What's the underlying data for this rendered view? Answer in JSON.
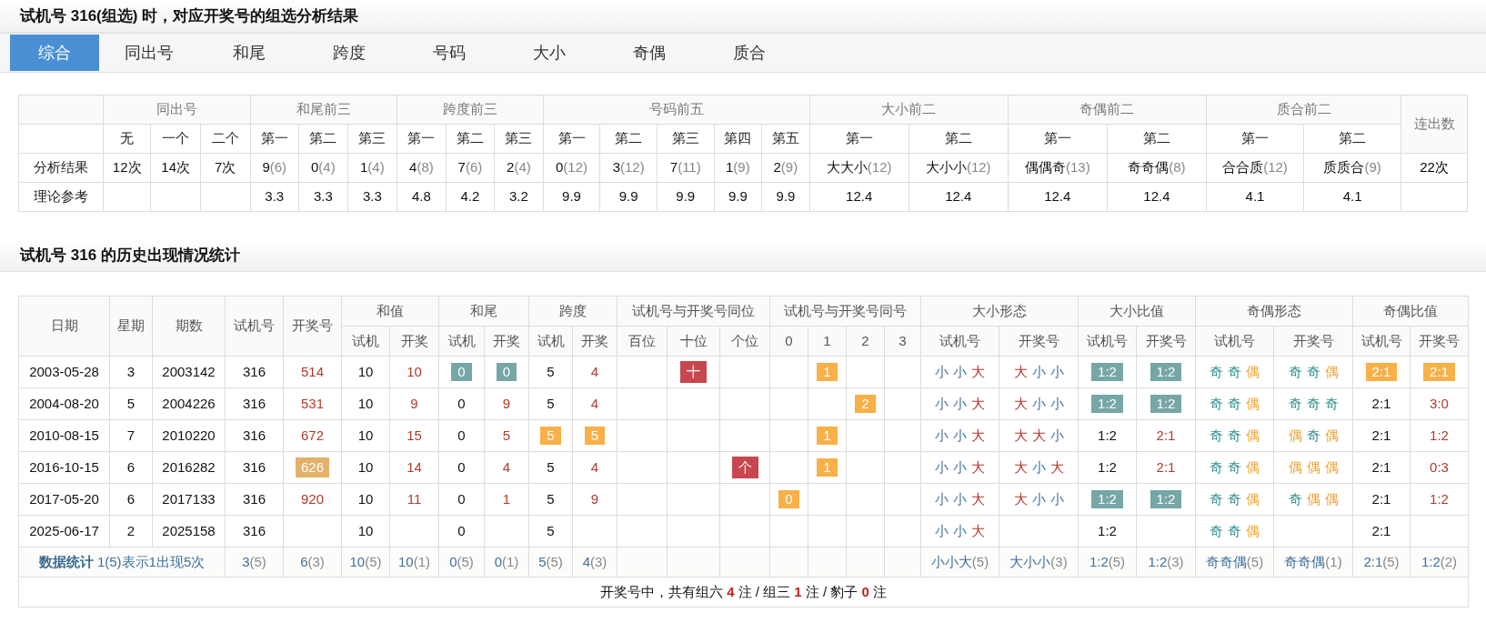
{
  "title": "试机号 316(组选) 时，对应开奖号的组选分析结果",
  "tabs": [
    {
      "label": "综合",
      "selected": true
    },
    {
      "label": "同出号",
      "selected": false
    },
    {
      "label": "和尾",
      "selected": false
    },
    {
      "label": "跨度",
      "selected": false
    },
    {
      "label": "号码",
      "selected": false
    },
    {
      "label": "大小",
      "selected": false
    },
    {
      "label": "奇偶",
      "selected": false
    },
    {
      "label": "质合",
      "selected": false
    }
  ],
  "summary": {
    "groups": [
      {
        "label": "同出号",
        "subs": [
          "无",
          "一个",
          "二个"
        ]
      },
      {
        "label": "和尾前三",
        "subs": [
          "第一",
          "第二",
          "第三"
        ]
      },
      {
        "label": "跨度前三",
        "subs": [
          "第一",
          "第二",
          "第三"
        ]
      },
      {
        "label": "号码前五",
        "subs": [
          "第一",
          "第二",
          "第三",
          "第四",
          "第五"
        ]
      },
      {
        "label": "大小前二",
        "subs": [
          "第一",
          "第二"
        ]
      },
      {
        "label": "奇偶前二",
        "subs": [
          "第一",
          "第二"
        ]
      },
      {
        "label": "质合前二",
        "subs": [
          "第一",
          "第二"
        ]
      }
    ],
    "tail_header": "连出数",
    "rows": [
      {
        "label": "分析结果",
        "cells": [
          {
            "v": "12次"
          },
          {
            "v": "14次"
          },
          {
            "v": "7次"
          },
          {
            "v": "9",
            "n": "(6)"
          },
          {
            "v": "0",
            "n": "(4)"
          },
          {
            "v": "1",
            "n": "(4)"
          },
          {
            "v": "4",
            "n": "(8)"
          },
          {
            "v": "7",
            "n": "(6)"
          },
          {
            "v": "2",
            "n": "(4)"
          },
          {
            "v": "0",
            "n": "(12)"
          },
          {
            "v": "3",
            "n": "(12)"
          },
          {
            "v": "7",
            "n": "(11)"
          },
          {
            "v": "1",
            "n": "(9)"
          },
          {
            "v": "2",
            "n": "(9)"
          },
          {
            "v": "大大小",
            "n": "(12)"
          },
          {
            "v": "大小小",
            "n": "(12)"
          },
          {
            "v": "偶偶奇",
            "n": "(13)"
          },
          {
            "v": "奇奇偶",
            "n": "(8)"
          },
          {
            "v": "合合质",
            "n": "(12)"
          },
          {
            "v": "质质合",
            "n": "(9)"
          }
        ],
        "tail": "22次"
      },
      {
        "label": "理论参考",
        "cells": [
          null,
          null,
          null,
          {
            "v": "3.3"
          },
          {
            "v": "3.3"
          },
          {
            "v": "3.3"
          },
          {
            "v": "4.8"
          },
          {
            "v": "4.2"
          },
          {
            "v": "3.2"
          },
          {
            "v": "9.9"
          },
          {
            "v": "9.9"
          },
          {
            "v": "9.9"
          },
          {
            "v": "9.9"
          },
          {
            "v": "9.9"
          },
          {
            "v": "12.4"
          },
          {
            "v": "12.4"
          },
          {
            "v": "12.4"
          },
          {
            "v": "12.4"
          },
          {
            "v": "4.1"
          },
          {
            "v": "4.1"
          }
        ]
      }
    ]
  },
  "history": {
    "title": "试机号 316 的历史出现情况统计",
    "groups": [
      {
        "label": "日期"
      },
      {
        "label": "星期"
      },
      {
        "label": "期数"
      },
      {
        "label": "试机号"
      },
      {
        "label": "开奖号"
      },
      {
        "label": "和值",
        "subs": [
          "试机",
          "开奖"
        ]
      },
      {
        "label": "和尾",
        "subs": [
          "试机",
          "开奖"
        ]
      },
      {
        "label": "跨度",
        "subs": [
          "试机",
          "开奖"
        ]
      },
      {
        "label": "试机号与开奖号同位",
        "subs": [
          "百位",
          "十位",
          "个位"
        ]
      },
      {
        "label": "试机号与开奖号同号",
        "subs": [
          "0",
          "1",
          "2",
          "3"
        ]
      },
      {
        "label": "大小形态",
        "subs": [
          "试机号",
          "开奖号"
        ]
      },
      {
        "label": "大小比值",
        "subs": [
          "试机号",
          "开奖号"
        ]
      },
      {
        "label": "奇偶形态",
        "subs": [
          "试机号",
          "开奖号"
        ]
      },
      {
        "label": "奇偶比值",
        "subs": [
          "试机号",
          "开奖号"
        ]
      }
    ],
    "rows": [
      [
        "2003-05-28",
        "3",
        "2003142",
        "316",
        {
          "t": "514",
          "kind": "draw"
        },
        "10",
        {
          "t": "10",
          "kind": "draw"
        },
        {
          "t": "0",
          "kind": "same"
        },
        {
          "t": "0",
          "kind": "same"
        },
        "5",
        {
          "t": "4",
          "kind": "draw"
        },
        null,
        {
          "t": "十",
          "kind": "position"
        },
        null,
        null,
        {
          "t": "1",
          "kind": "hit"
        },
        null,
        null,
        {
          "chars": [
            {
              "t": "小",
              "kind": "small"
            },
            {
              "t": "小",
              "kind": "small"
            },
            {
              "t": "大",
              "kind": "big"
            }
          ]
        },
        {
          "chars": [
            {
              "t": "大",
              "kind": "big"
            },
            {
              "t": "小",
              "kind": "small"
            },
            {
              "t": "小",
              "kind": "small"
            }
          ]
        },
        {
          "t": "1:2",
          "kind": "same"
        },
        {
          "t": "1:2",
          "kind": "same"
        },
        {
          "chars": [
            {
              "t": "奇",
              "kind": "odd"
            },
            {
              "t": "奇",
              "kind": "odd"
            },
            {
              "t": "偶",
              "kind": "even"
            }
          ]
        },
        {
          "chars": [
            {
              "t": "奇",
              "kind": "odd"
            },
            {
              "t": "奇",
              "kind": "odd"
            },
            {
              "t": "偶",
              "kind": "even"
            }
          ]
        },
        {
          "t": "2:1",
          "kind": "hit"
        },
        {
          "t": "2:1",
          "kind": "hit"
        }
      ],
      [
        "2004-08-20",
        "5",
        "2004226",
        "316",
        {
          "t": "531",
          "kind": "draw"
        },
        "10",
        {
          "t": "9",
          "kind": "draw"
        },
        "0",
        {
          "t": "9",
          "kind": "draw"
        },
        "5",
        {
          "t": "4",
          "kind": "draw"
        },
        null,
        null,
        null,
        null,
        null,
        {
          "t": "2",
          "kind": "hit"
        },
        null,
        {
          "chars": [
            {
              "t": "小",
              "kind": "small"
            },
            {
              "t": "小",
              "kind": "small"
            },
            {
              "t": "大",
              "kind": "big"
            }
          ]
        },
        {
          "chars": [
            {
              "t": "大",
              "kind": "big"
            },
            {
              "t": "小",
              "kind": "small"
            },
            {
              "t": "小",
              "kind": "small"
            }
          ]
        },
        {
          "t": "1:2",
          "kind": "same"
        },
        {
          "t": "1:2",
          "kind": "same"
        },
        {
          "chars": [
            {
              "t": "奇",
              "kind": "odd"
            },
            {
              "t": "奇",
              "kind": "odd"
            },
            {
              "t": "偶",
              "kind": "even"
            }
          ]
        },
        {
          "chars": [
            {
              "t": "奇",
              "kind": "odd"
            },
            {
              "t": "奇",
              "kind": "odd"
            },
            {
              "t": "奇",
              "kind": "odd"
            }
          ]
        },
        "2:1",
        {
          "t": "3:0",
          "kind": "draw"
        }
      ],
      [
        "2010-08-15",
        "7",
        "2010220",
        "316",
        {
          "t": "672",
          "kind": "draw"
        },
        "10",
        {
          "t": "15",
          "kind": "draw"
        },
        "0",
        {
          "t": "5",
          "kind": "draw"
        },
        {
          "t": "5",
          "kind": "hit"
        },
        {
          "t": "5",
          "kind": "hit"
        },
        null,
        null,
        null,
        null,
        {
          "t": "1",
          "kind": "hit"
        },
        null,
        null,
        {
          "chars": [
            {
              "t": "小",
              "kind": "small"
            },
            {
              "t": "小",
              "kind": "small"
            },
            {
              "t": "大",
              "kind": "big"
            }
          ]
        },
        {
          "chars": [
            {
              "t": "大",
              "kind": "big"
            },
            {
              "t": "大",
              "kind": "big"
            },
            {
              "t": "小",
              "kind": "small"
            }
          ]
        },
        "1:2",
        {
          "t": "2:1",
          "kind": "draw"
        },
        {
          "chars": [
            {
              "t": "奇",
              "kind": "odd"
            },
            {
              "t": "奇",
              "kind": "odd"
            },
            {
              "t": "偶",
              "kind": "even"
            }
          ]
        },
        {
          "chars": [
            {
              "t": "偶",
              "kind": "even"
            },
            {
              "t": "奇",
              "kind": "odd"
            },
            {
              "t": "偶",
              "kind": "even"
            }
          ]
        },
        "2:1",
        {
          "t": "1:2",
          "kind": "draw"
        }
      ],
      [
        "2016-10-15",
        "6",
        "2016282",
        "316",
        {
          "t": "626",
          "kind": "pair"
        },
        "10",
        {
          "t": "14",
          "kind": "draw"
        },
        "0",
        {
          "t": "4",
          "kind": "draw"
        },
        "5",
        {
          "t": "4",
          "kind": "draw"
        },
        null,
        null,
        {
          "t": "个",
          "kind": "position"
        },
        null,
        {
          "t": "1",
          "kind": "hit"
        },
        null,
        null,
        {
          "chars": [
            {
              "t": "小",
              "kind": "small"
            },
            {
              "t": "小",
              "kind": "small"
            },
            {
              "t": "大",
              "kind": "big"
            }
          ]
        },
        {
          "chars": [
            {
              "t": "大",
              "kind": "big"
            },
            {
              "t": "小",
              "kind": "small"
            },
            {
              "t": "大",
              "kind": "big"
            }
          ]
        },
        "1:2",
        {
          "t": "2:1",
          "kind": "draw"
        },
        {
          "chars": [
            {
              "t": "奇",
              "kind": "odd"
            },
            {
              "t": "奇",
              "kind": "odd"
            },
            {
              "t": "偶",
              "kind": "even"
            }
          ]
        },
        {
          "chars": [
            {
              "t": "偶",
              "kind": "even"
            },
            {
              "t": "偶",
              "kind": "even"
            },
            {
              "t": "偶",
              "kind": "even"
            }
          ]
        },
        "2:1",
        {
          "t": "0:3",
          "kind": "draw"
        }
      ],
      [
        "2017-05-20",
        "6",
        "2017133",
        "316",
        {
          "t": "920",
          "kind": "draw"
        },
        "10",
        {
          "t": "11",
          "kind": "draw"
        },
        "0",
        {
          "t": "1",
          "kind": "draw"
        },
        "5",
        {
          "t": "9",
          "kind": "draw"
        },
        null,
        null,
        null,
        {
          "t": "0",
          "kind": "hit"
        },
        null,
        null,
        null,
        {
          "chars": [
            {
              "t": "小",
              "kind": "small"
            },
            {
              "t": "小",
              "kind": "small"
            },
            {
              "t": "大",
              "kind": "big"
            }
          ]
        },
        {
          "chars": [
            {
              "t": "大",
              "kind": "big"
            },
            {
              "t": "小",
              "kind": "small"
            },
            {
              "t": "小",
              "kind": "small"
            }
          ]
        },
        {
          "t": "1:2",
          "kind": "same"
        },
        {
          "t": "1:2",
          "kind": "same"
        },
        {
          "chars": [
            {
              "t": "奇",
              "kind": "odd"
            },
            {
              "t": "奇",
              "kind": "odd"
            },
            {
              "t": "偶",
              "kind": "even"
            }
          ]
        },
        {
          "chars": [
            {
              "t": "奇",
              "kind": "odd"
            },
            {
              "t": "偶",
              "kind": "even"
            },
            {
              "t": "偶",
              "kind": "even"
            }
          ]
        },
        "2:1",
        {
          "t": "1:2",
          "kind": "draw"
        }
      ],
      [
        "2025-06-17",
        "2",
        "2025158",
        "316",
        null,
        "10",
        null,
        "0",
        null,
        "5",
        null,
        null,
        null,
        null,
        null,
        null,
        null,
        null,
        {
          "chars": [
            {
              "t": "小",
              "kind": "small"
            },
            {
              "t": "小",
              "kind": "small"
            },
            {
              "t": "大",
              "kind": "big"
            }
          ]
        },
        null,
        "1:2",
        null,
        {
          "chars": [
            {
              "t": "奇",
              "kind": "odd"
            },
            {
              "t": "奇",
              "kind": "odd"
            },
            {
              "t": "偶",
              "kind": "even"
            }
          ]
        },
        null,
        "2:1",
        null
      ]
    ],
    "stats": {
      "label": "数据统计",
      "note": "1(5)表示1出现5次",
      "cells": [
        {
          "v": "3",
          "n": "(5)"
        },
        {
          "v": "6",
          "n": "(3)"
        },
        {
          "v": "10",
          "n": "(5)"
        },
        {
          "v": "10",
          "n": "(1)"
        },
        {
          "v": "0",
          "n": "(5)"
        },
        {
          "v": "0",
          "n": "(1)"
        },
        {
          "v": "5",
          "n": "(5)"
        },
        {
          "v": "4",
          "n": "(3)"
        },
        null,
        null,
        null,
        null,
        null,
        null,
        null,
        {
          "v": "小小大",
          "n": "(5)"
        },
        {
          "v": "大小小",
          "n": "(3)"
        },
        {
          "v": "1:2",
          "n": "(5)"
        },
        {
          "v": "1:2",
          "n": "(3)"
        },
        {
          "v": "奇奇偶",
          "n": "(5)"
        },
        {
          "v": "奇奇偶",
          "n": "(1)"
        },
        {
          "v": "2:1",
          "n": "(5)"
        },
        {
          "v": "1:2",
          "n": "(2)"
        }
      ]
    },
    "footer": "开奖号中，共有组六 **4** 注 / 组三 **1** 注 / 豹子 **0** 注"
  }
}
